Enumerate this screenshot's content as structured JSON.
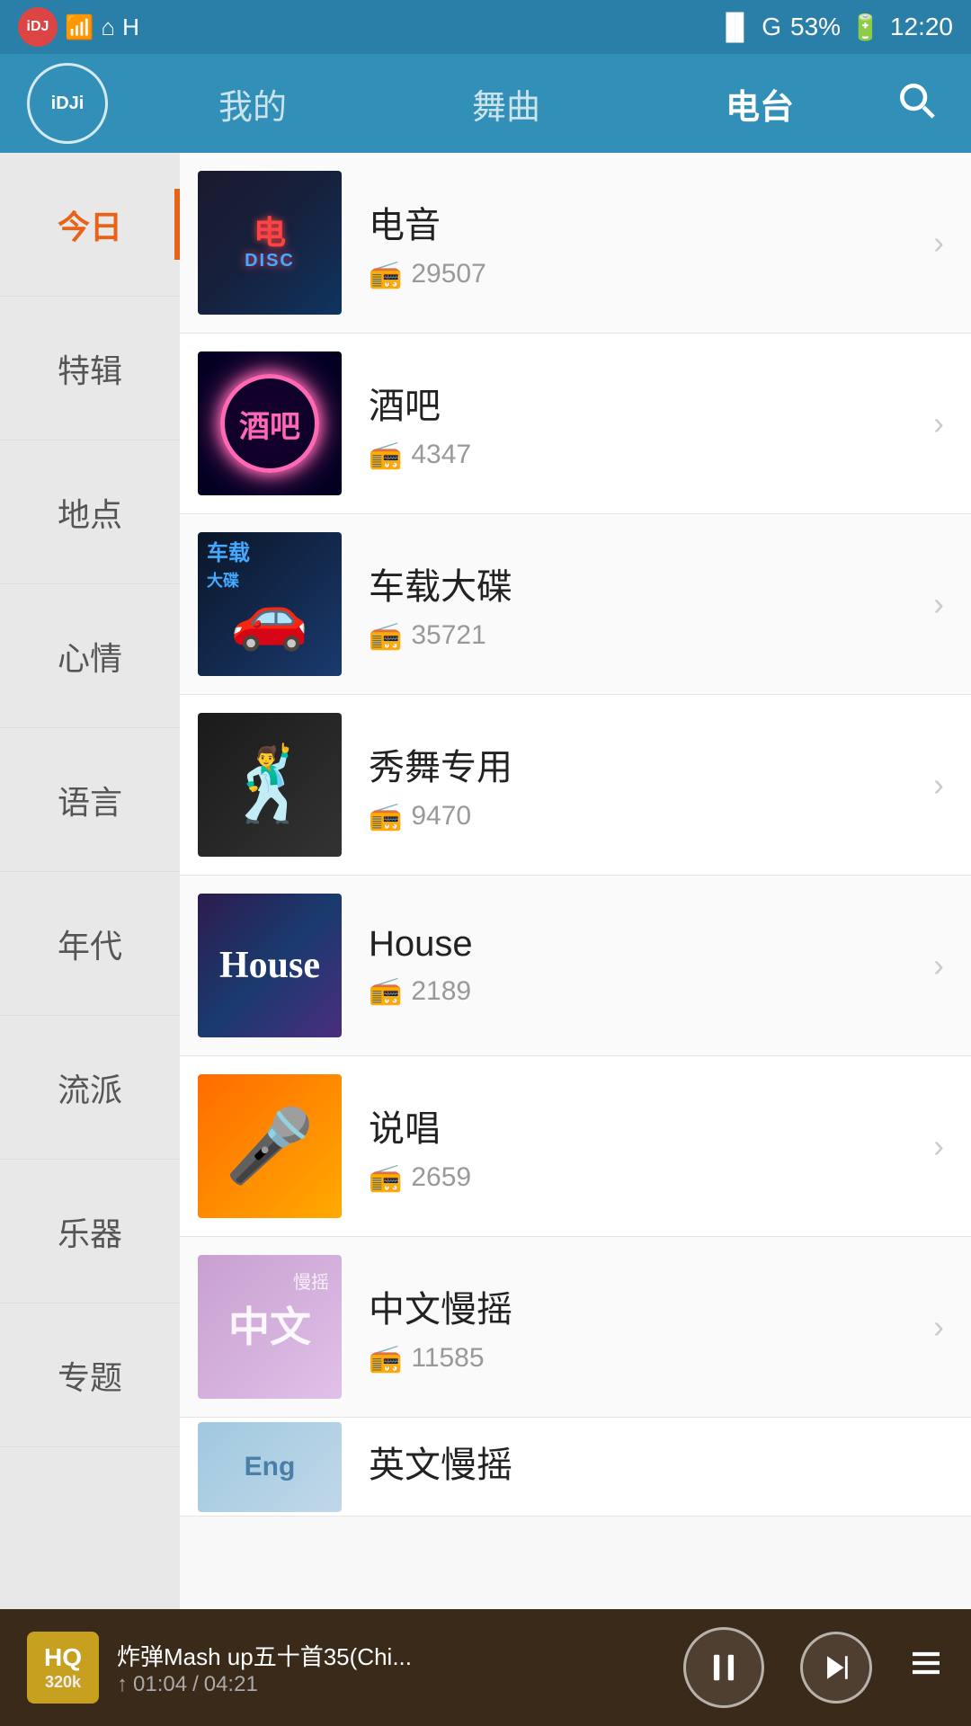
{
  "statusBar": {
    "time": "12:20",
    "battery": "53%",
    "signal": "G"
  },
  "header": {
    "logo": "iDJi",
    "tabs": [
      {
        "label": "我的",
        "active": false
      },
      {
        "label": "舞曲",
        "active": false
      },
      {
        "label": "电台",
        "active": true
      }
    ],
    "searchLabel": "search"
  },
  "sidebar": {
    "items": [
      {
        "label": "今日",
        "active": true
      },
      {
        "label": "特辑",
        "active": false
      },
      {
        "label": "地点",
        "active": false
      },
      {
        "label": "心情",
        "active": false
      },
      {
        "label": "语言",
        "active": false
      },
      {
        "label": "年代",
        "active": false
      },
      {
        "label": "流派",
        "active": false
      },
      {
        "label": "乐器",
        "active": false
      },
      {
        "label": "专题",
        "active": false
      }
    ]
  },
  "radioList": [
    {
      "name": "电音",
      "listeners": "29507",
      "thumb_type": "dianyin"
    },
    {
      "name": "酒吧",
      "listeners": "4347",
      "thumb_type": "jiuba"
    },
    {
      "name": "车载大碟",
      "listeners": "35721",
      "thumb_type": "chezai"
    },
    {
      "name": "秀舞专用",
      "listeners": "9470",
      "thumb_type": "xiuwu"
    },
    {
      "name": "House",
      "listeners": "2189",
      "thumb_type": "house"
    },
    {
      "name": "说唱",
      "listeners": "2659",
      "thumb_type": "shuochang"
    },
    {
      "name": "中文慢摇",
      "listeners": "11585",
      "thumb_type": "zhongwen"
    },
    {
      "name": "英文慢摇",
      "listeners": "",
      "thumb_type": "yingwen"
    }
  ],
  "player": {
    "hq_label": "HQ",
    "quality": "320k",
    "title": "炸弹Mash up五十首35(Chi...",
    "time_elapsed": "01:04",
    "time_total": "04:21"
  }
}
